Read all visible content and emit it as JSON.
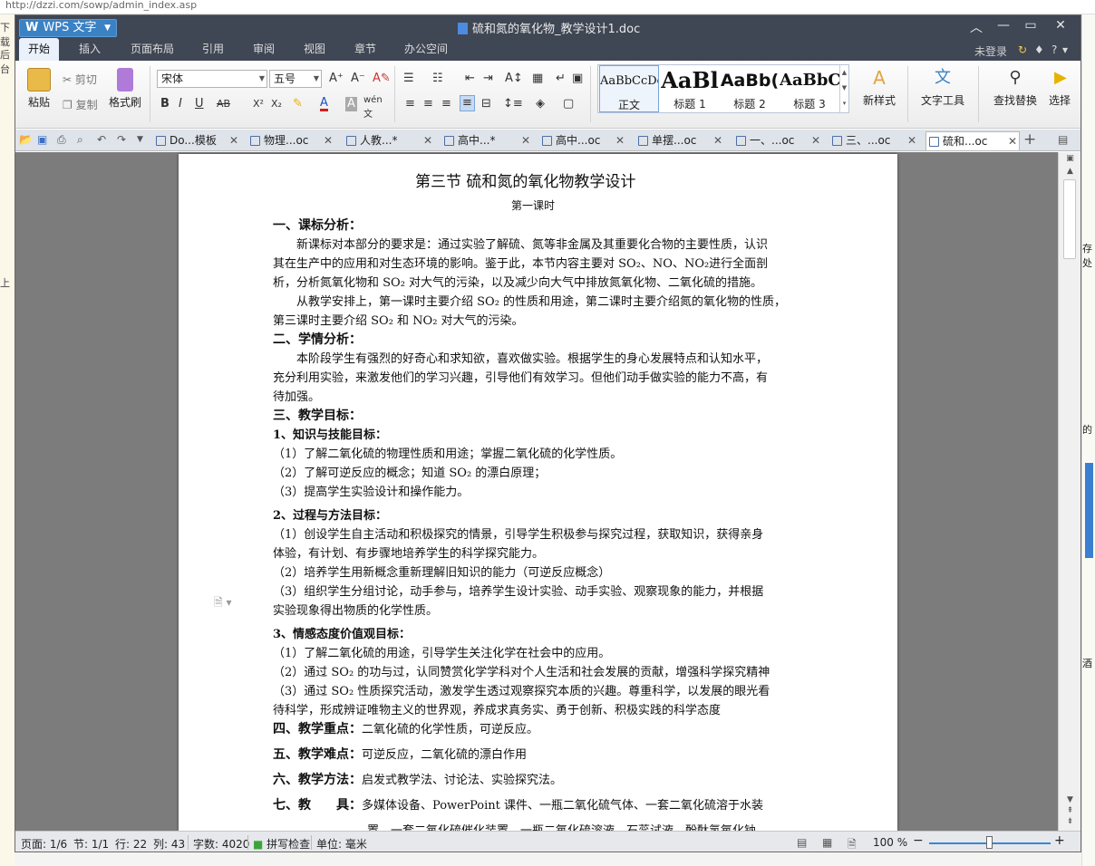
{
  "background": {
    "browser_url": "http://dzzi.com/sowp/admin_index.asp",
    "left_fragments": [
      "下载",
      "后台",
      "上"
    ],
    "right_fragments": [
      "存处",
      "的",
      "酒"
    ]
  },
  "window": {
    "app_name": "WPS 文字",
    "doc_title": "硫和氮的氧化物_教学设计1.doc",
    "controls": [
      "︿",
      "—",
      "▭",
      "✕"
    ]
  },
  "menubar": {
    "items": [
      "开始",
      "插入",
      "页面布局",
      "引用",
      "审阅",
      "视图",
      "章节",
      "办公空间"
    ],
    "active": "开始",
    "login": "未登录",
    "right_icons": [
      "↻",
      "👕",
      "?",
      "·"
    ]
  },
  "ribbon": {
    "paste": "粘贴",
    "cut": "剪切",
    "copy": "复制",
    "format_painter": "格式刷",
    "font_name": "宋体",
    "font_size": "五号",
    "styles": [
      {
        "preview": "AaBbCcDd",
        "name": "正文"
      },
      {
        "preview": "AaBl",
        "name": "标题 1"
      },
      {
        "preview": "AaBb(",
        "name": "标题 2"
      },
      {
        "preview": "AaBbC",
        "name": "标题 3"
      }
    ],
    "new_style": "新样式",
    "text_tools": "文字工具",
    "find_replace": "查找替换",
    "select": "选择"
  },
  "tabs": [
    {
      "label": "Do...模板",
      "active": false
    },
    {
      "label": "物理...oc",
      "active": false
    },
    {
      "label": "人教...*",
      "active": false
    },
    {
      "label": "高中...*",
      "active": false
    },
    {
      "label": "高中...oc",
      "active": false
    },
    {
      "label": "单摆...oc",
      "active": false
    },
    {
      "label": "一、...oc",
      "active": false
    },
    {
      "label": "三、...oc",
      "active": false
    },
    {
      "label": "硫和...oc",
      "active": true
    }
  ],
  "document": {
    "title": "第三节 硫和氮的氧化物教学设计",
    "subtitle": "第一课时",
    "lines": [
      {
        "kind": "h",
        "text": "一、课标分析："
      },
      {
        "kind": "p",
        "text": "　　新课标对本部分的要求是：通过实验了解硫、氮等非金属及其重要化合物的主要性质，认识"
      },
      {
        "kind": "p",
        "text": "其在生产中的应用和对生态环境的影响。鉴于此，本节内容主要对 SO₂、NO、NO₂进行全面剖"
      },
      {
        "kind": "p",
        "text": "析，分析氮氧化物和 SO₂ 对大气的污染，以及减少向大气中排放氮氧化物、二氧化硫的措施。"
      },
      {
        "kind": "p",
        "text": "　　从教学安排上，第一课时主要介绍 SO₂ 的性质和用途，第二课时主要介绍氮的氧化物的性质，"
      },
      {
        "kind": "p",
        "text": "第三课时主要介绍 SO₂ 和 NO₂ 对大气的污染。"
      },
      {
        "kind": "h",
        "text": "二、学情分析："
      },
      {
        "kind": "p",
        "text": "　　本阶段学生有强烈的好奇心和求知欲，喜欢做实验。根据学生的身心发展特点和认知水平，"
      },
      {
        "kind": "p",
        "text": "充分利用实验，来激发他们的学习兴趣，引导他们有效学习。但他们动手做实验的能力不高，有"
      },
      {
        "kind": "p",
        "text": "待加强。"
      },
      {
        "kind": "h",
        "text": "三、教学目标："
      },
      {
        "kind": "h3",
        "text": "1、知识与技能目标："
      },
      {
        "kind": "p",
        "text": "（1）了解二氧化硫的物理性质和用途；掌握二氧化硫的化学性质。"
      },
      {
        "kind": "p",
        "text": "（2）了解可逆反应的概念；知道 SO₂ 的漂白原理；"
      },
      {
        "kind": "p",
        "text": "（3）提高学生实验设计和操作能力。"
      },
      {
        "kind": "h3",
        "text": "2、过程与方法目标："
      },
      {
        "kind": "p",
        "text": "（1）创设学生自主活动和积极探究的情景，引导学生积极参与探究过程，获取知识，获得亲身"
      },
      {
        "kind": "p",
        "text": "体验，有计划、有步骤地培养学生的科学探究能力。"
      },
      {
        "kind": "p",
        "text": "（2）培养学生用新概念重新理解旧知识的能力（可逆反应概念）"
      },
      {
        "kind": "p",
        "text": "（3）组织学生分组讨论，动手参与，培养学生设计实验、动手实验、观察现象的能力，并根据"
      },
      {
        "kind": "p",
        "text": "实验现象得出物质的化学性质。"
      },
      {
        "kind": "h3",
        "text": "3、情感态度价值观目标："
      },
      {
        "kind": "p",
        "text": "（1）了解二氧化硫的用途，引导学生关注化学在社会中的应用。"
      },
      {
        "kind": "p",
        "text": "（2）通过 SO₂ 的功与过，认同赞赏化学学科对个人生活和社会发展的贡献，增强科学探究精神"
      },
      {
        "kind": "p",
        "text": "（3）通过 SO₂ 性质探究活动，激发学生透过观察探究本质的兴趣。尊重科学，以发展的眼光看"
      },
      {
        "kind": "p",
        "text": "待科学，形成辨证唯物主义的世界观，养成求真务实、勇于创新、积极实践的科学态度"
      },
      {
        "kind": "hp",
        "head": "四、教学重点：",
        "text": "二氧化硫的化学性质，可逆反应。"
      },
      {
        "kind": "hp",
        "head": "五、教学难点：",
        "text": "可逆反应，二氧化硫的漂白作用"
      },
      {
        "kind": "hp",
        "head": "六、教学方法：",
        "text": "启发式教学法、讨论法、实验探究法。"
      },
      {
        "kind": "hp",
        "head": "七、教　　具：",
        "text": "多媒体设备、PowerPoint 课件、一瓶二氧化硫气体、一套二氧化硫溶于水装"
      },
      {
        "kind": "p",
        "text": "　　　　　　　　置、一套二氧化硫催化装置、一瓶二氧化硫溶液、石蕊试液、酚酞氢氧化钠"
      }
    ]
  },
  "statusbar": {
    "page": "页面: 1/6",
    "section": "节: 1/1",
    "row": "行: 22",
    "col": "列: 43",
    "words": "字数: 4020",
    "spell": "拼写检查",
    "unit": "单位: 毫米",
    "zoom": "100 %",
    "zoom_level": 0.5
  },
  "colors": {
    "titlebar": "#3f4654",
    "accent": "#3b82c4",
    "page_bg": "#ffffff",
    "workspace": "#7c7c7c"
  }
}
